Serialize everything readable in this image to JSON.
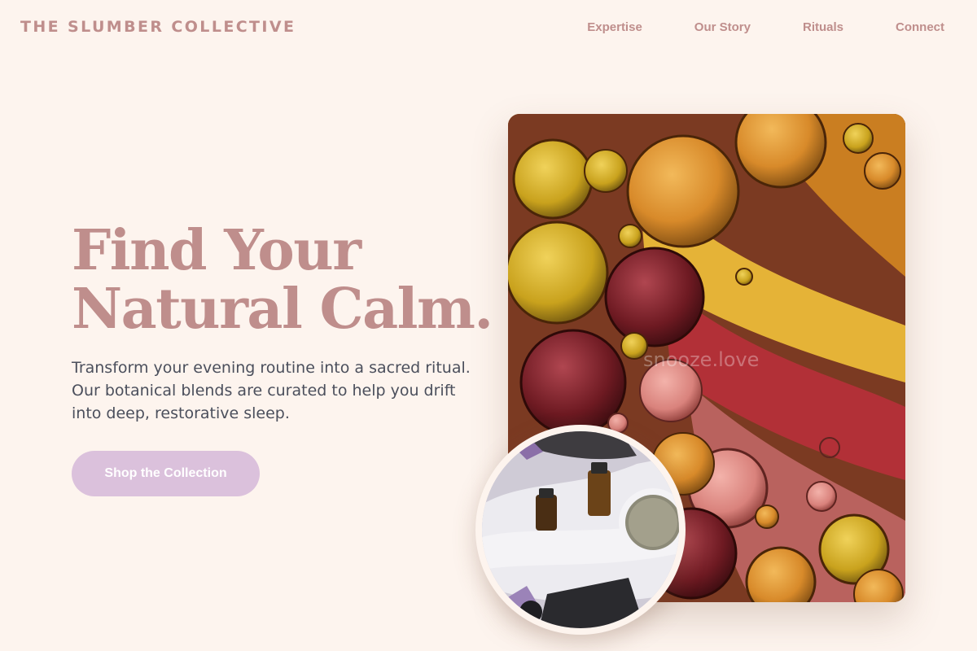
{
  "header": {
    "brand": "THE SLUMBER COLLECTIVE",
    "nav": [
      "Expertise",
      "Our Story",
      "Rituals",
      "Connect"
    ]
  },
  "hero": {
    "title_line1": "Find Your",
    "title_line2": "Natural Calm.",
    "description": "Transform your evening routine into a sacred ritual. Our botanical blends are curated to help you drift into deep, restorative sleep.",
    "cta_label": "Shop the Collection"
  },
  "images": {
    "main": "oil-droplets-photo",
    "inset": "essential-oils-lavender-photo",
    "watermark": "snooze.love"
  },
  "colors": {
    "background": "#fdf4ee",
    "brand": "#bf8e8c",
    "body_text": "#4b4f5c",
    "cta": "#dbc1dc"
  }
}
